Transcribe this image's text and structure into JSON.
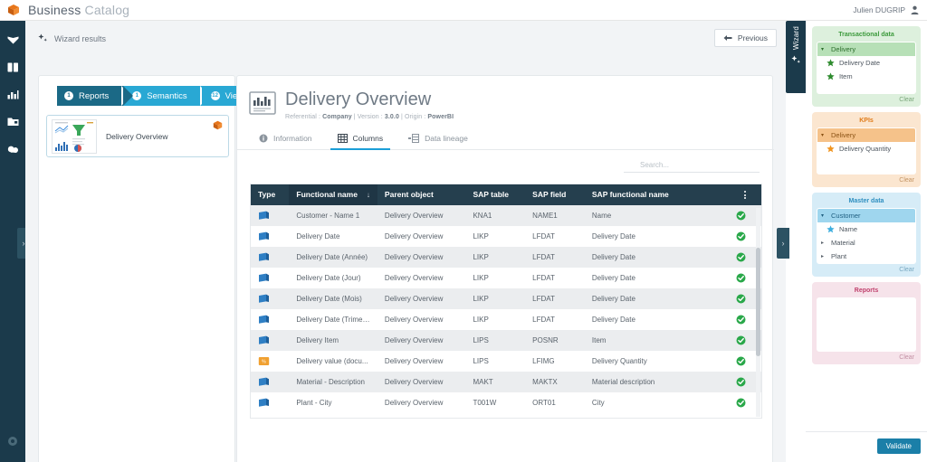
{
  "app": {
    "brand_primary": "Business",
    "brand_secondary": "Catalog",
    "logo_icon": "cube-icon",
    "user_name": "Julien DUGRIP",
    "user_icon": "user-avatar-icon",
    "accent_color": "#1b9fd8",
    "dark_color": "#1b3a4b",
    "orange_color": "#e8761a"
  },
  "rail": {
    "items": [
      {
        "icon": "book-open-icon",
        "name": "rail-item-catalog"
      },
      {
        "icon": "books-icon",
        "name": "rail-item-glossary"
      },
      {
        "icon": "bar-chart-icon",
        "name": "rail-item-reports"
      },
      {
        "icon": "folder-icon",
        "name": "rail-item-projects"
      },
      {
        "icon": "cloud-icon",
        "name": "rail-item-connections"
      }
    ],
    "bottom_icon": "settings-icon",
    "collapse_handle": "›"
  },
  "toolbar": {
    "wizard_results_label": "Wizard results",
    "wizard_results_icon": "sparkle-icon",
    "previous_label": "Previous",
    "previous_icon": "arrow-left-icon"
  },
  "stepper": {
    "steps": [
      {
        "label": "Reports",
        "count": "1",
        "state": "done"
      },
      {
        "label": "Semantics",
        "count": "1",
        "state": "done"
      },
      {
        "label": "Views",
        "count": "12",
        "state": "current"
      }
    ]
  },
  "report_card": {
    "name": "Delivery Overview",
    "thumb_icon": "report-thumbnail",
    "flag_icon": "powerbi-cube-icon"
  },
  "document": {
    "icon": "report-document-icon",
    "title": "Delivery Overview",
    "meta": {
      "referential_label": "Referential :",
      "referential_value": "Company",
      "version_label": "Version :",
      "version_value": "3.0.0",
      "origin_label": "Origin :",
      "origin_value": "PowerBI",
      "separator": "|"
    }
  },
  "tabs": [
    {
      "label": "Information",
      "icon": "info-circle-icon",
      "active": false
    },
    {
      "label": "Columns",
      "icon": "grid-table-icon",
      "active": true
    },
    {
      "label": "Data lineage",
      "icon": "lineage-icon",
      "active": false
    }
  ],
  "search": {
    "placeholder": "Search...",
    "value": "",
    "icon": "search-icon"
  },
  "table": {
    "columns": [
      {
        "label": "Type",
        "key": "type"
      },
      {
        "label": "Functional name",
        "key": "functional_name",
        "sorted": true,
        "sort_icon": "↓"
      },
      {
        "label": "Parent object",
        "key": "parent_object"
      },
      {
        "label": "SAP table",
        "key": "sap_table"
      },
      {
        "label": "SAP field",
        "key": "sap_field"
      },
      {
        "label": "SAP functional name",
        "key": "sap_functional_name"
      },
      {
        "label": "",
        "key": "status",
        "menu_icon": "kebab-menu-icon"
      }
    ],
    "rows": [
      {
        "type_icon": "dimension-blue-icon",
        "functional_name": "Customer - Name 1",
        "parent_object": "Delivery Overview",
        "sap_table": "KNA1",
        "sap_field": "NAME1",
        "sap_functional_name": "Name",
        "status": "valid"
      },
      {
        "type_icon": "dimension-blue-icon",
        "functional_name": "Delivery Date",
        "parent_object": "Delivery Overview",
        "sap_table": "LIKP",
        "sap_field": "LFDAT",
        "sap_functional_name": "Delivery Date",
        "status": "valid"
      },
      {
        "type_icon": "dimension-blue-icon",
        "functional_name": "Delivery Date (Année)",
        "parent_object": "Delivery Overview",
        "sap_table": "LIKP",
        "sap_field": "LFDAT",
        "sap_functional_name": "Delivery Date",
        "status": "valid"
      },
      {
        "type_icon": "dimension-blue-icon",
        "functional_name": "Delivery Date (Jour)",
        "parent_object": "Delivery Overview",
        "sap_table": "LIKP",
        "sap_field": "LFDAT",
        "sap_functional_name": "Delivery Date",
        "status": "valid"
      },
      {
        "type_icon": "dimension-blue-icon",
        "functional_name": "Delivery Date (Mois)",
        "parent_object": "Delivery Overview",
        "sap_table": "LIKP",
        "sap_field": "LFDAT",
        "sap_functional_name": "Delivery Date",
        "status": "valid"
      },
      {
        "type_icon": "dimension-blue-icon",
        "functional_name": "Delivery Date (Trimes...",
        "parent_object": "Delivery Overview",
        "sap_table": "LIKP",
        "sap_field": "LFDAT",
        "sap_functional_name": "Delivery Date",
        "status": "valid"
      },
      {
        "type_icon": "dimension-blue-icon",
        "functional_name": "Delivery Item",
        "parent_object": "Delivery Overview",
        "sap_table": "LIPS",
        "sap_field": "POSNR",
        "sap_functional_name": "Item",
        "status": "valid"
      },
      {
        "type_icon": "kpi-orange-icon",
        "functional_name": "Delivery value (docu...",
        "parent_object": "Delivery Overview",
        "sap_table": "LIPS",
        "sap_field": "LFIMG",
        "sap_functional_name": "Delivery Quantity",
        "status": "valid"
      },
      {
        "type_icon": "dimension-blue-icon",
        "functional_name": "Material - Description",
        "parent_object": "Delivery Overview",
        "sap_table": "MAKT",
        "sap_field": "MAKTX",
        "sap_functional_name": "Material description",
        "status": "valid"
      },
      {
        "type_icon": "dimension-blue-icon",
        "functional_name": "Plant - City",
        "parent_object": "Delivery Overview",
        "sap_table": "T001W",
        "sap_field": "ORT01",
        "sap_functional_name": "City",
        "status": "valid"
      }
    ]
  },
  "wizard_tab": {
    "label": "Wizard",
    "icon": "sparkle-icon",
    "collapse_handle": "›"
  },
  "drawer": {
    "baskets": [
      {
        "title": "Transactional data",
        "theme": "green",
        "clear_label": "Clear",
        "groups": [
          {
            "label": "Delivery",
            "expanded": true,
            "caret": "▾",
            "items": [
              {
                "label": "Delivery Date",
                "icon": "star-icon"
              },
              {
                "label": "Item",
                "icon": "star-icon"
              }
            ]
          }
        ]
      },
      {
        "title": "KPIs",
        "theme": "orange",
        "clear_label": "Clear",
        "groups": [
          {
            "label": "Delivery",
            "expanded": true,
            "caret": "▾",
            "items": [
              {
                "label": "Delivery Quantity",
                "icon": "star-icon"
              }
            ]
          }
        ]
      },
      {
        "title": "Master data",
        "theme": "blue",
        "clear_label": "Clear",
        "groups": [
          {
            "label": "Customer",
            "expanded": true,
            "caret": "▾",
            "items": [
              {
                "label": "Name",
                "icon": "star-icon"
              }
            ]
          }
        ],
        "collapsed_groups": [
          {
            "label": "Material",
            "caret": "▸"
          },
          {
            "label": "Plant",
            "caret": "▸"
          }
        ]
      },
      {
        "title": "Reports",
        "theme": "pink",
        "clear_label": "Clear",
        "groups": []
      }
    ],
    "validate_label": "Validate"
  }
}
